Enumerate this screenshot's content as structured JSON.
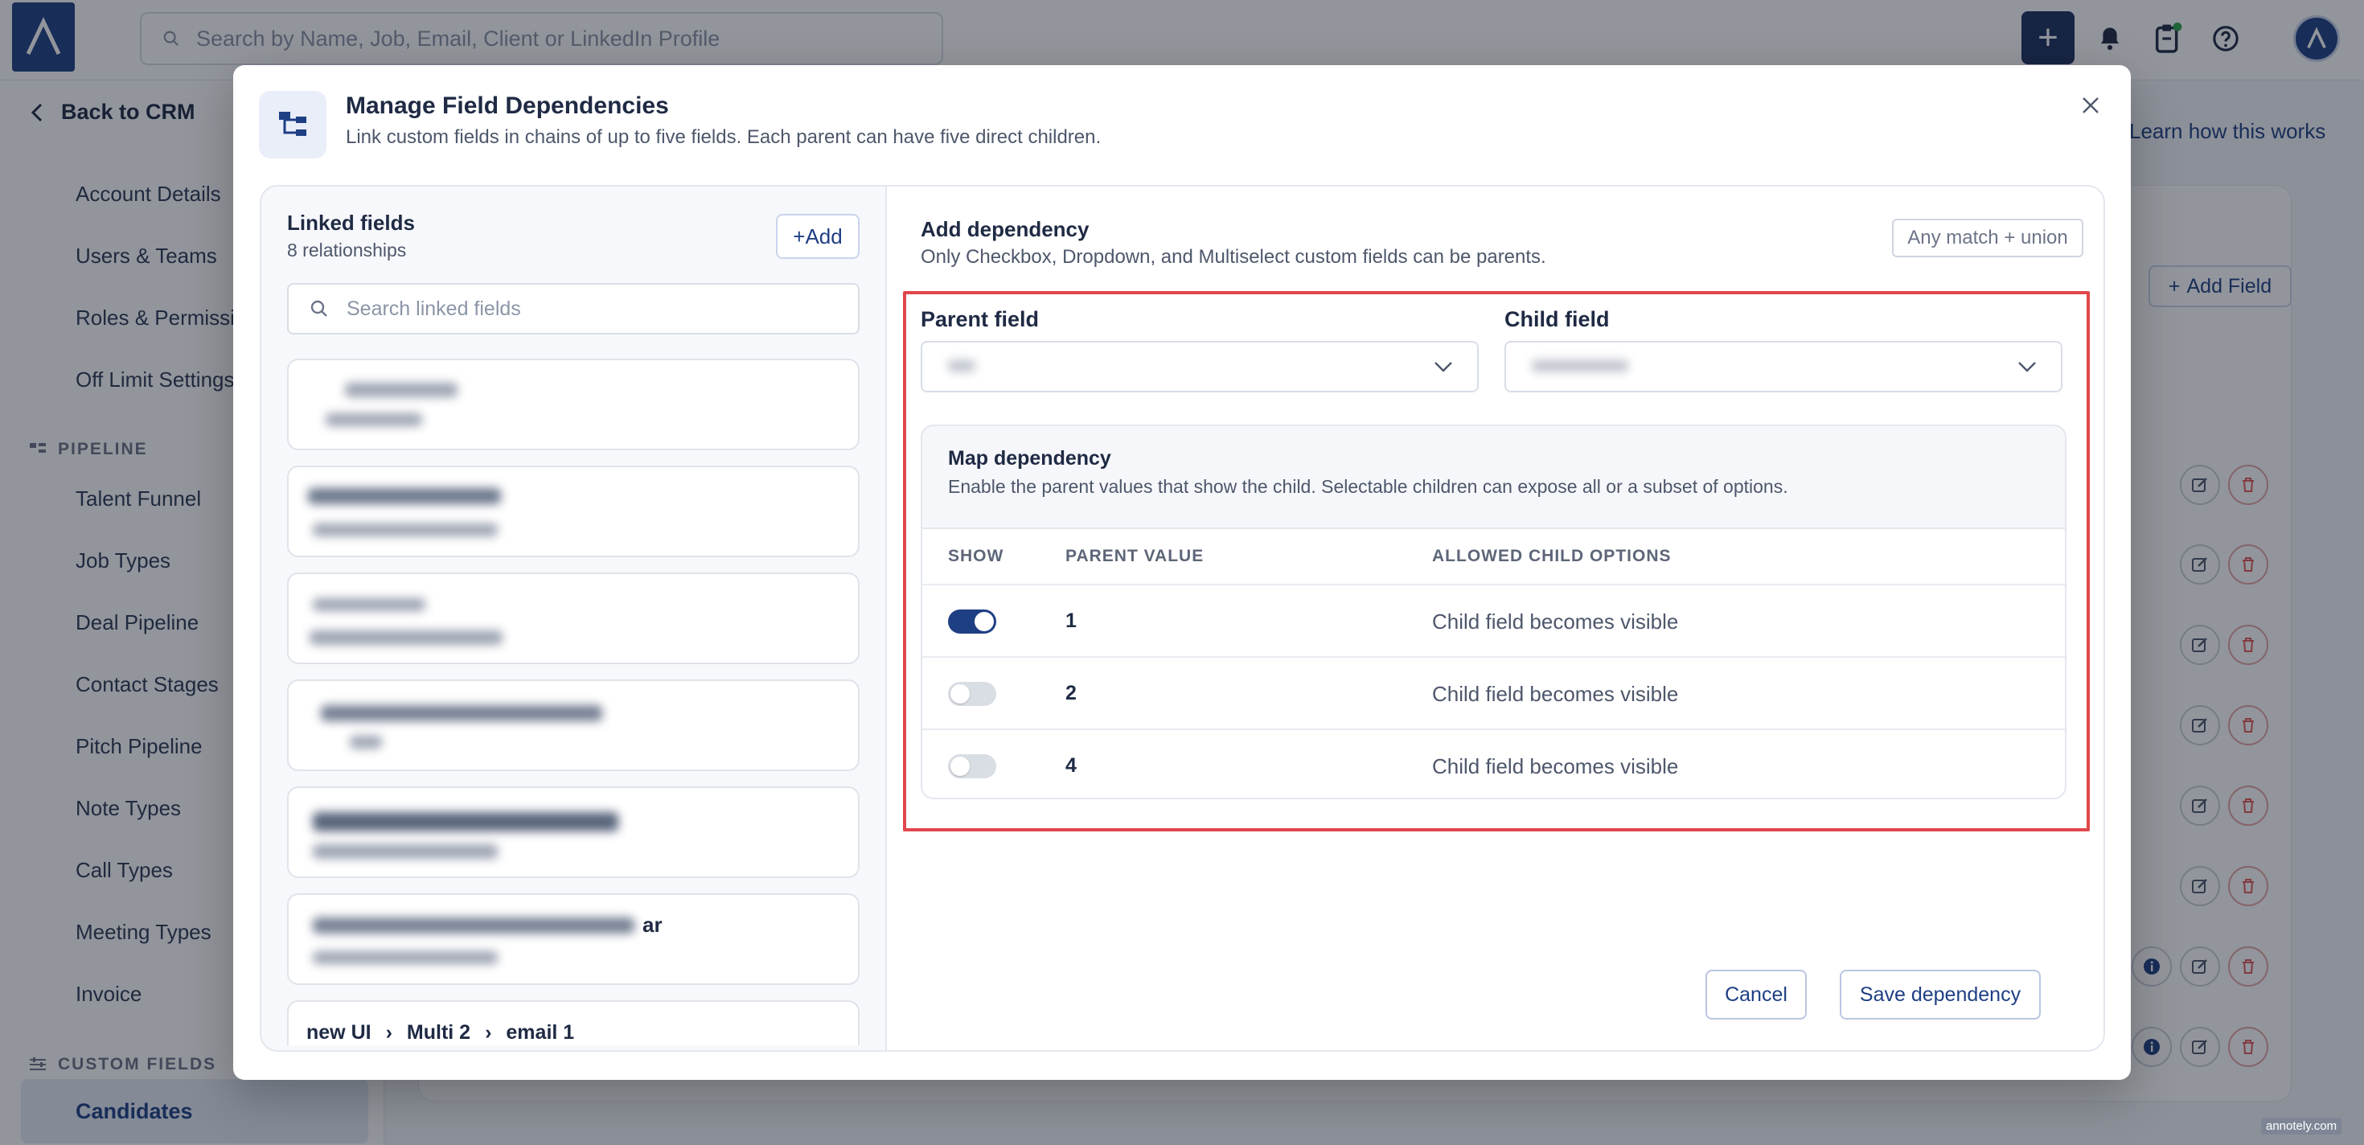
{
  "header": {
    "search_placeholder": "Search by Name, Job, Email, Client or LinkedIn Profile"
  },
  "sidebar": {
    "back_label": "Back to CRM",
    "items": [
      "Account Details",
      "Users & Teams",
      "Roles & Permissi",
      "Off Limit Settings"
    ],
    "pipeline_heading": "PIPELINE",
    "pipeline_items": [
      "Talent Funnel",
      "Job Types",
      "Deal Pipeline",
      "Contact Stages",
      "Pitch Pipeline",
      "Note Types",
      "Call Types",
      "Meeting Types",
      "Invoice"
    ],
    "custom_fields_heading": "CUSTOM FIELDS",
    "active_item": "Candidates"
  },
  "background": {
    "learn_link": "Learn how this works",
    "add_field_label": "Add Field"
  },
  "modal": {
    "title": "Manage Field Dependencies",
    "subtitle": "Link custom fields in chains of up to five fields. Each parent can have five direct children.",
    "linked": {
      "title": "Linked fields",
      "count": "8 relationships",
      "add_label": "Add",
      "search_placeholder": "Search linked fields",
      "partial_text_card6": "ar",
      "partial_chain": [
        "new UI",
        "Multi 2",
        "email 1"
      ]
    },
    "add_dependency": {
      "title": "Add dependency",
      "subtitle": "Only Checkbox, Dropdown, and Multiselect custom fields can be parents.",
      "match_chip": "Any match + union",
      "parent_label": "Parent field",
      "child_label": "Child field"
    },
    "map": {
      "title": "Map dependency",
      "subtitle": "Enable the parent values that show the child. Selectable children can expose all or a subset of options.",
      "headers": [
        "SHOW",
        "PARENT VALUE",
        "ALLOWED CHILD OPTIONS"
      ],
      "rows": [
        {
          "on": true,
          "value": "1",
          "option": "Child field becomes visible"
        },
        {
          "on": false,
          "value": "2",
          "option": "Child field becomes visible"
        },
        {
          "on": false,
          "value": "4",
          "option": "Child field becomes visible"
        }
      ]
    },
    "cancel_label": "Cancel",
    "save_label": "Save dependency"
  },
  "watermark": "annotely.com",
  "colors": {
    "primary": "#1f3f84",
    "highlight": "#e0474c",
    "danger": "#e05a5a"
  }
}
